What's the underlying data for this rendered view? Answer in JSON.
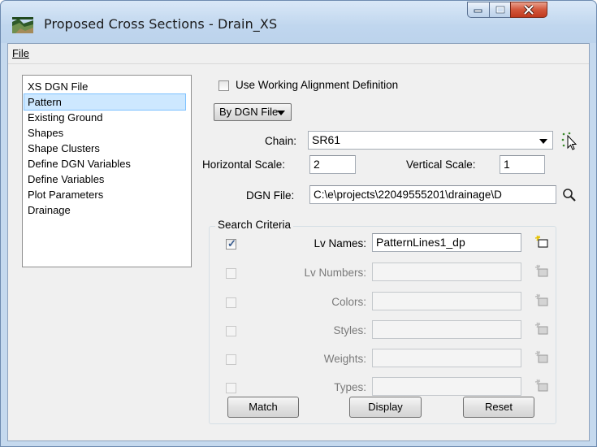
{
  "window": {
    "title": "Proposed Cross Sections - Drain_XS"
  },
  "menu": {
    "file": "File"
  },
  "sidebar": {
    "items": [
      {
        "label": "XS DGN File",
        "selected": false
      },
      {
        "label": "Pattern",
        "selected": true
      },
      {
        "label": "Existing Ground",
        "selected": false
      },
      {
        "label": "Shapes",
        "selected": false
      },
      {
        "label": "Shape Clusters",
        "selected": false
      },
      {
        "label": "Define DGN Variables",
        "selected": false
      },
      {
        "label": "Define Variables",
        "selected": false
      },
      {
        "label": "Plot Parameters",
        "selected": false
      },
      {
        "label": "Drainage",
        "selected": false
      }
    ]
  },
  "main": {
    "use_working_alignment": {
      "label": "Use Working Alignment Definition",
      "checked": false
    },
    "mode_dropdown": {
      "value": "By DGN File"
    },
    "chain": {
      "label": "Chain:",
      "value": "SR61"
    },
    "horizontal_scale": {
      "label": "Horizontal Scale:",
      "value": "2"
    },
    "vertical_scale": {
      "label": "Vertical Scale:",
      "value": "1"
    },
    "dgn_file": {
      "label": "DGN File:",
      "value": "C:\\e\\projects\\22049555201\\drainage\\D"
    },
    "search_criteria": {
      "title": "Search Criteria",
      "rows": [
        {
          "label": "Lv Names:",
          "value": "PatternLines1_dp",
          "checked": true,
          "enabled": true
        },
        {
          "label": "Lv Numbers:",
          "value": "",
          "checked": false,
          "enabled": false
        },
        {
          "label": "Colors:",
          "value": "",
          "checked": false,
          "enabled": false
        },
        {
          "label": "Styles:",
          "value": "",
          "checked": false,
          "enabled": false
        },
        {
          "label": "Weights:",
          "value": "",
          "checked": false,
          "enabled": false
        },
        {
          "label": "Types:",
          "value": "",
          "checked": false,
          "enabled": false
        }
      ]
    },
    "buttons": {
      "match": "Match",
      "display": "Display",
      "reset": "Reset"
    }
  },
  "colors": {
    "titlebar": "#c5d9ee",
    "selection": "#cde8ff",
    "close_button": "#c0391d"
  }
}
